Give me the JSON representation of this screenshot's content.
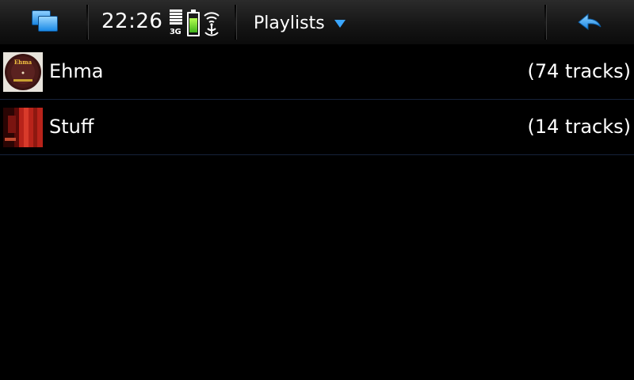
{
  "statusbar": {
    "clock": "22:26",
    "network_type": "3G",
    "signal_bars": 5,
    "battery_level": 0.75,
    "icons": {
      "task_switcher": "task-switcher-icon",
      "signal": "signal-strength-icon",
      "battery": "battery-icon",
      "wifi": "wifi-icon",
      "back": "back-arrow-icon"
    },
    "accent_color": "#3aa6ff"
  },
  "header": {
    "title": "Playlists"
  },
  "playlists": [
    {
      "name": "Ehma",
      "track_count": "(74 tracks)",
      "cover_icon": "album-cover-ehma-icon",
      "cover_label": "Ehma"
    },
    {
      "name": "Stuff",
      "track_count": "(14 tracks)",
      "cover_icon": "album-cover-stuff-icon"
    }
  ]
}
